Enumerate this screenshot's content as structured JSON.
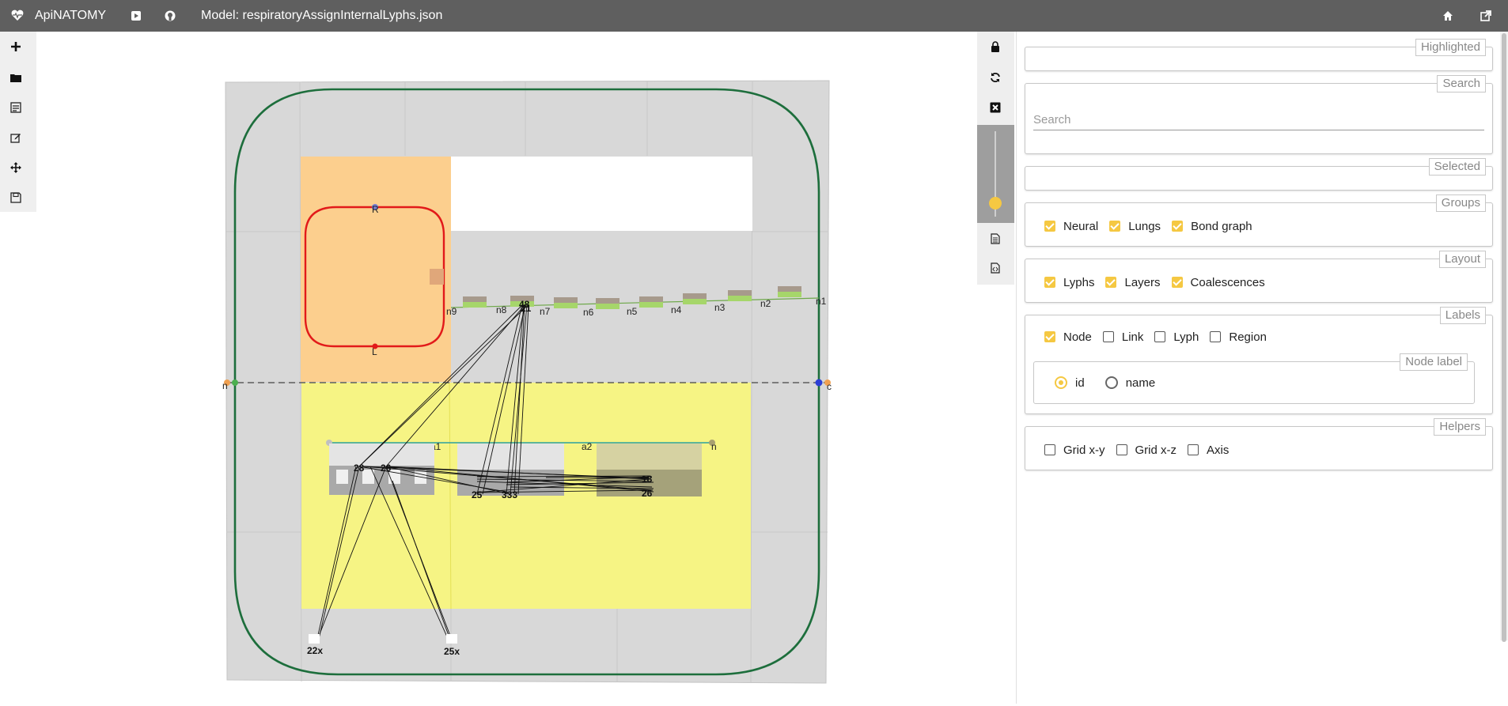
{
  "topbar": {
    "app_name": "ApiNATOMY",
    "model_prefix": "Model:",
    "model_file": "respiratoryAssignInternalLyphs.json",
    "icons": [
      "heartbeat-icon",
      "youtube-icon",
      "github-icon",
      "home-icon",
      "external-link-icon"
    ]
  },
  "left_toolbar": [
    "plus-icon",
    "folder-icon",
    "merge-icon",
    "edit-icon",
    "move-icon",
    "save-icon"
  ],
  "right_toolbar": [
    "lock-icon",
    "refresh-icon",
    "close-icon",
    "zoom-slider",
    "file-icon",
    "code-file-icon"
  ],
  "canvas": {
    "node_labels": {
      "n9": "n9",
      "n8": "n8",
      "n7": "n7",
      "n6": "n6",
      "n5": "n5",
      "n4": "n4",
      "n3": "n3",
      "n2": "n2",
      "n1": "n1",
      "R": "R",
      "L": "L",
      "a1": "a1",
      "a2": "a2",
      "n": "n",
      "c": "c",
      "nleft": "n",
      "l28": "28",
      "l26": "26",
      "l48": "48",
      "l21": "21",
      "l25": "25",
      "l333": "333",
      "l18": "18",
      "l26b": "26",
      "l22x": "22x",
      "l25x": "25x"
    }
  },
  "panel": {
    "highlighted": {
      "legend": "Highlighted"
    },
    "search": {
      "legend": "Search",
      "placeholder": "Search"
    },
    "selected": {
      "legend": "Selected"
    },
    "groups": {
      "legend": "Groups",
      "items": [
        {
          "label": "Neural",
          "checked": true
        },
        {
          "label": "Lungs",
          "checked": true
        },
        {
          "label": "Bond graph",
          "checked": true
        }
      ]
    },
    "layout": {
      "legend": "Layout",
      "items": [
        {
          "label": "Lyphs",
          "checked": true
        },
        {
          "label": "Layers",
          "checked": true
        },
        {
          "label": "Coalescences",
          "checked": true
        }
      ]
    },
    "labels": {
      "legend": "Labels",
      "items": [
        {
          "label": "Node",
          "checked": true
        },
        {
          "label": "Link",
          "checked": false
        },
        {
          "label": "Lyph",
          "checked": false
        },
        {
          "label": "Region",
          "checked": false
        }
      ],
      "node_label": {
        "legend": "Node label",
        "options": [
          {
            "label": "id",
            "selected": true
          },
          {
            "label": "name",
            "selected": false
          }
        ]
      }
    },
    "helpers": {
      "legend": "Helpers",
      "items": [
        {
          "label": "Grid x-y",
          "checked": false
        },
        {
          "label": "Grid x-z",
          "checked": false
        },
        {
          "label": "Axis",
          "checked": false
        }
      ]
    }
  },
  "colors": {
    "topbar": "#5f5f5f",
    "accent": "#f5c842",
    "region_orange": "#fccf8e",
    "region_yellow": "#f6f484",
    "grid_gray": "#d8d8d8",
    "outer_loop": "#1d6e3c",
    "inner_loop": "#e21a1a"
  }
}
